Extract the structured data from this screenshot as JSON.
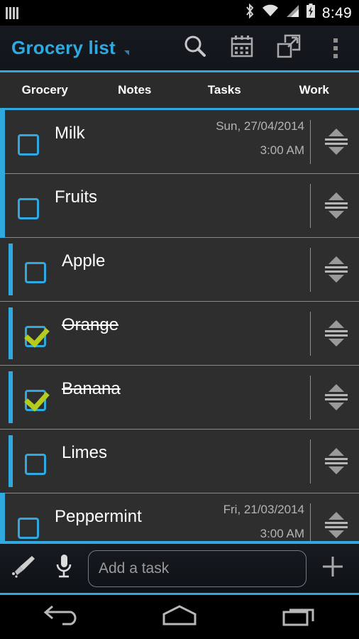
{
  "status_bar": {
    "time": "8:49",
    "left_icons": [
      "equalizer-bars-icon"
    ],
    "right_icons": [
      "bluetooth-icon",
      "wifi-icon",
      "cellular-signal-icon",
      "battery-charging-icon"
    ]
  },
  "action_bar": {
    "title": "Grocery list",
    "title_color": "#2fa9e0",
    "has_dropdown_caret": true,
    "actions": [
      {
        "name": "search-icon",
        "label": "Search"
      },
      {
        "name": "calendar-icon",
        "label": "Calendar"
      },
      {
        "name": "share-external-icon",
        "label": "Share"
      },
      {
        "name": "overflow-menu-icon",
        "label": "More options"
      }
    ]
  },
  "tabs": {
    "active_index": 0,
    "items": [
      {
        "label": "Grocery"
      },
      {
        "label": "Notes"
      },
      {
        "label": "Tasks"
      },
      {
        "label": "Work"
      }
    ]
  },
  "list": {
    "items": [
      {
        "title": "Milk",
        "level": 0,
        "checked": false,
        "date": "Sun, 27/04/2014",
        "time": "3:00 AM"
      },
      {
        "title": "Fruits",
        "level": 0,
        "checked": false,
        "date": "",
        "time": ""
      },
      {
        "title": "Apple",
        "level": 1,
        "checked": false,
        "date": "",
        "time": ""
      },
      {
        "title": "Orange",
        "level": 1,
        "checked": true,
        "date": "",
        "time": ""
      },
      {
        "title": "Banana",
        "level": 1,
        "checked": true,
        "date": "",
        "time": ""
      },
      {
        "title": "Limes",
        "level": 1,
        "checked": false,
        "date": "",
        "time": ""
      },
      {
        "title": "Peppermint",
        "level": 0,
        "checked": false,
        "date": "Fri, 21/03/2014",
        "time": "3:00 AM"
      }
    ]
  },
  "add_bar": {
    "broom_icon": "broom-clean-icon",
    "mic_icon": "microphone-icon",
    "input_value": "",
    "input_placeholder": "Add a task",
    "plus_icon": "plus-icon"
  },
  "nav_bar": {
    "buttons": [
      {
        "name": "back-button"
      },
      {
        "name": "home-button"
      },
      {
        "name": "recents-button"
      }
    ]
  },
  "colors": {
    "accent": "#2fa9e0",
    "check": "#b5cb1e",
    "list_bg": "#2e2e2e",
    "tab_bg": "#2b2b2b"
  }
}
